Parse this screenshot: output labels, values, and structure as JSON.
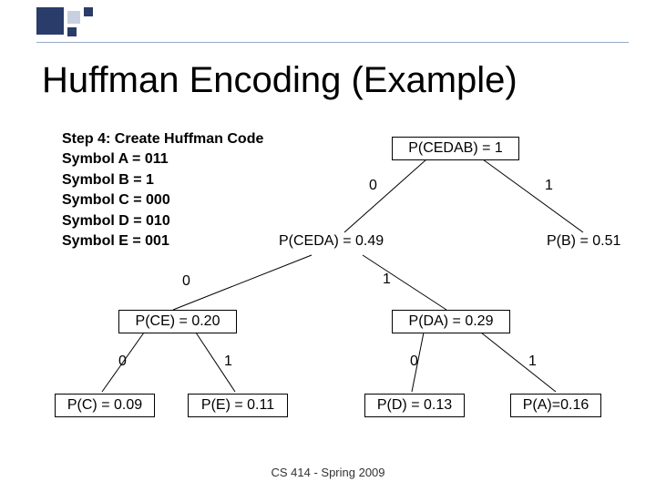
{
  "title": "Huffman Encoding (Example)",
  "step": {
    "heading": "Step 4: Create Huffman Code",
    "lines": {
      "a": "Symbol A = 011",
      "b": "Symbol B = 1",
      "c": "Symbol C = 000",
      "d": "Symbol D = 010",
      "e": "Symbol E = 001"
    }
  },
  "nodes": {
    "root": "P(CEDAB) = 1",
    "ceda": "P(CEDA) = 0.49",
    "b": "P(B) = 0.51",
    "ce": "P(CE) = 0.20",
    "da": "P(DA) = 0.29",
    "c": "P(C) = 0.09",
    "e": "P(E) = 0.11",
    "d": "P(D) = 0.13",
    "a": "P(A)=0.16"
  },
  "edges": {
    "root_left": "0",
    "root_right": "1",
    "ceda_left": "0",
    "ceda_right": "1",
    "ce_left": "0",
    "ce_right": "1",
    "da_left": "0",
    "da_right": "1"
  },
  "footer": "CS 414 - Spring 2009",
  "chart_data": {
    "type": "tree",
    "title": "Huffman coding tree",
    "nodes": [
      {
        "id": "CEDAB",
        "probability": 1.0
      },
      {
        "id": "CEDA",
        "probability": 0.49
      },
      {
        "id": "B",
        "probability": 0.51,
        "code": "1"
      },
      {
        "id": "CE",
        "probability": 0.2
      },
      {
        "id": "DA",
        "probability": 0.29
      },
      {
        "id": "C",
        "probability": 0.09,
        "code": "000"
      },
      {
        "id": "E",
        "probability": 0.11,
        "code": "001"
      },
      {
        "id": "D",
        "probability": 0.13,
        "code": "010"
      },
      {
        "id": "A",
        "probability": 0.16,
        "code": "011"
      }
    ],
    "edges": [
      {
        "from": "CEDAB",
        "to": "CEDA",
        "bit": 0
      },
      {
        "from": "CEDAB",
        "to": "B",
        "bit": 1
      },
      {
        "from": "CEDA",
        "to": "CE",
        "bit": 0
      },
      {
        "from": "CEDA",
        "to": "DA",
        "bit": 1
      },
      {
        "from": "CE",
        "to": "C",
        "bit": 0
      },
      {
        "from": "CE",
        "to": "E",
        "bit": 1
      },
      {
        "from": "DA",
        "to": "D",
        "bit": 0
      },
      {
        "from": "DA",
        "to": "A",
        "bit": 1
      }
    ]
  }
}
